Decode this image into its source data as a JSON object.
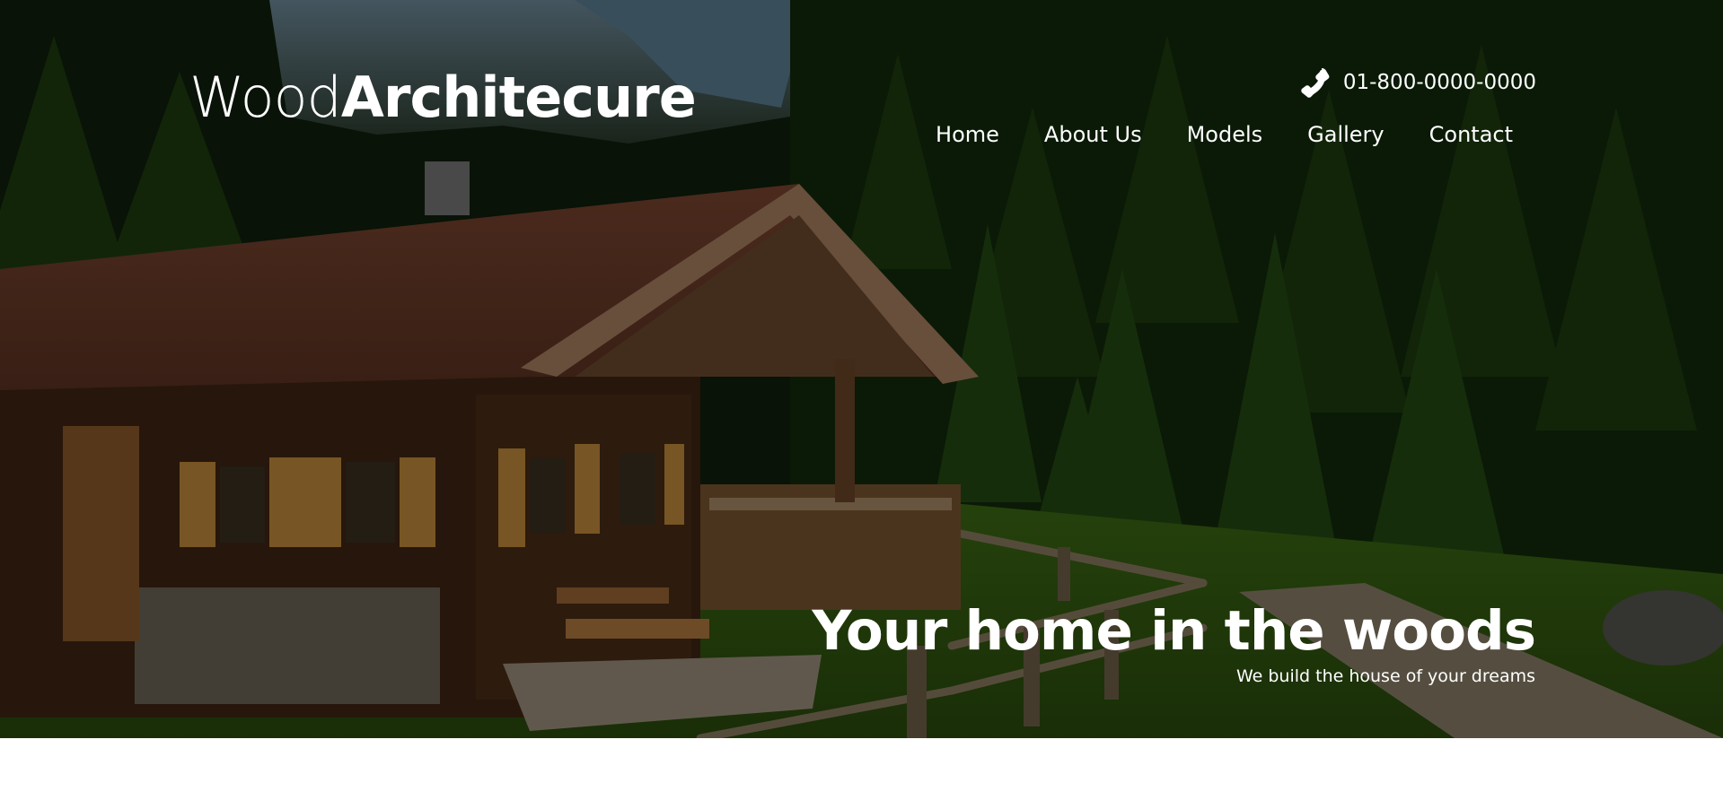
{
  "brand": {
    "light": "Wood",
    "bold": "Architecure"
  },
  "contact": {
    "phone": "01-800-0000-0000",
    "icon": "phone-icon"
  },
  "nav": {
    "items": [
      {
        "label": "Home"
      },
      {
        "label": "About Us"
      },
      {
        "label": "Models"
      },
      {
        "label": "Gallery"
      },
      {
        "label": "Contact"
      }
    ]
  },
  "hero": {
    "headline": "Your home in the woods",
    "subheadline": "We build the house of your dreams",
    "image": "wooden-cabin-in-forest"
  },
  "colors": {
    "text": "#ffffff",
    "page_bg": "#ffffff",
    "overlay": "#000000"
  }
}
